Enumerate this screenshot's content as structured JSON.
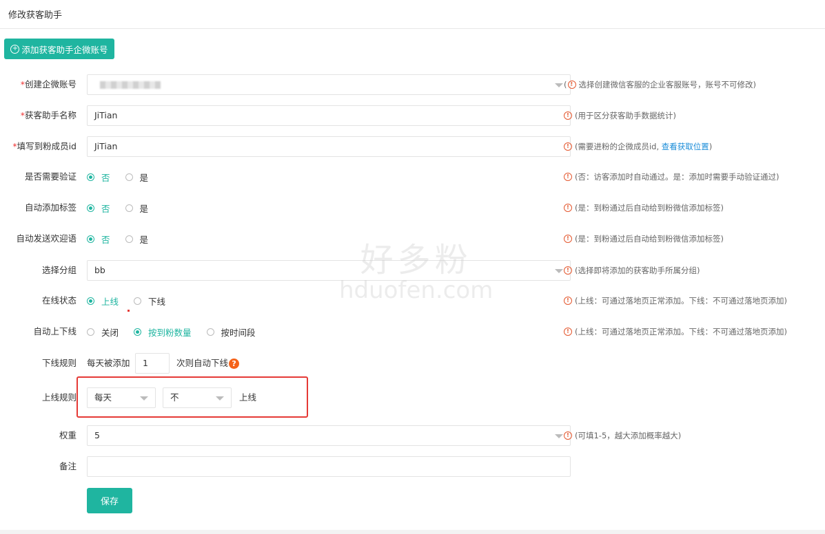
{
  "title": "修改获客助手",
  "add_button": {
    "label": "添加获客助手企微账号"
  },
  "fields": {
    "account": {
      "required": "*",
      "label": "创建企微账号",
      "hint": "选择创建微信客服的企业客服账号，账号不可修改)"
    },
    "name": {
      "required": "*",
      "label": "获客助手名称",
      "value": "JiTian",
      "hint": "(用于区分获客助手数据统计)"
    },
    "member_id": {
      "required": "*",
      "label": "填写到粉成员id",
      "value": "JiTian",
      "hint_pre": "(需要进粉的企微成员id,",
      "hint_link": "查看获取位置",
      "hint_post": ")"
    },
    "verify": {
      "label": "是否需要验证",
      "options": [
        "否",
        "是"
      ],
      "selected": "否",
      "hint": "(否：访客添加时自动通过。是：添加时需要手动验证通过)"
    },
    "auto_tag": {
      "label": "自动添加标签",
      "options": [
        "否",
        "是"
      ],
      "selected": "否",
      "hint": "(是：到粉通过后自动给到粉微信添加标签)"
    },
    "welcome": {
      "label": "自动发送欢迎语",
      "options": [
        "否",
        "是"
      ],
      "selected": "否",
      "hint": "(是：到粉通过后自动给到粉微信添加标签)"
    },
    "group": {
      "label": "选择分组",
      "value": "bb",
      "hint": "(选择即将添加的获客助手所属分组)"
    },
    "status": {
      "label": "在线状态",
      "options": [
        "上线",
        "下线"
      ],
      "selected": "上线",
      "hint": "(上线：可通过落地页正常添加。下线：不可通过落地页添加)"
    },
    "auto_online": {
      "label": "自动上下线",
      "options": [
        "关闭",
        "按到粉数量",
        "按时间段"
      ],
      "selected": "按到粉数量",
      "hint": "(上线：可通过落地页正常添加。下线：不可通过落地页添加)"
    },
    "offline_rule": {
      "label": "下线规则",
      "prefix": "每天被添加",
      "value": "1",
      "suffix": "次则自动下线",
      "help": "?"
    },
    "online_rule": {
      "label": "上线规则",
      "select1": "每天",
      "select2": "不",
      "suffix": "上线"
    },
    "weight": {
      "label": "权重",
      "value": "5",
      "hint": "(可填1-5，越大添加概率越大)"
    },
    "note": {
      "label": "备注",
      "value": ""
    }
  },
  "save_button": {
    "label": "保存"
  },
  "watermark": {
    "line1": "好多粉",
    "line2": "hduofen.com"
  },
  "colors": {
    "accent": "#1fb5a0",
    "hint_icon": "#e4572e",
    "link": "#1a8cd8",
    "highlight": "#e53935"
  }
}
